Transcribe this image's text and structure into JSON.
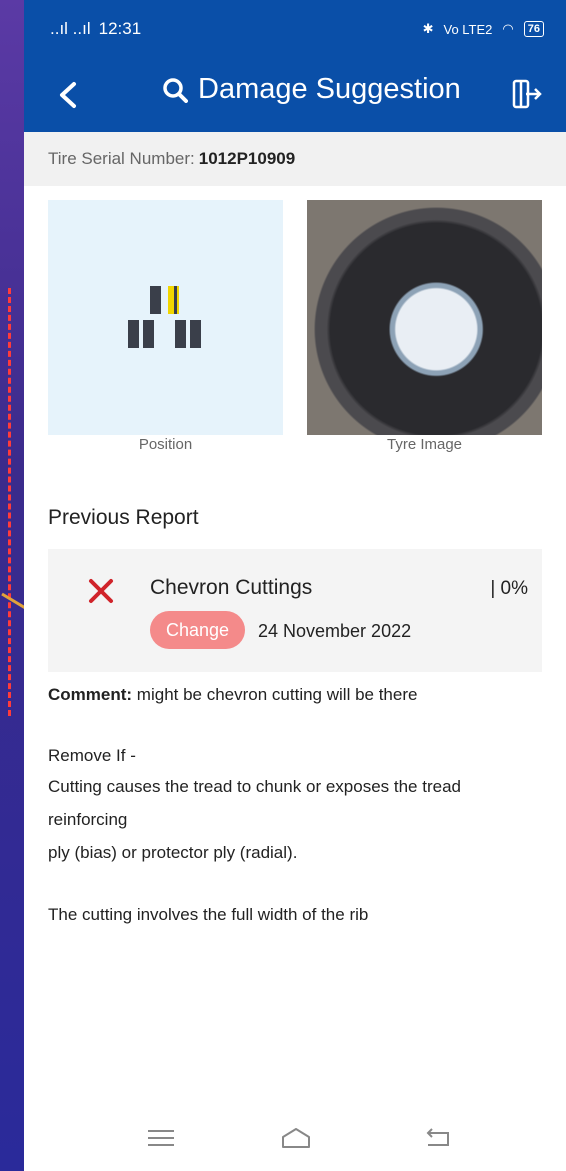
{
  "status_bar": {
    "signal": "..ıl ..ıl",
    "time": "12:31",
    "network": "Vo LTE2",
    "battery": "76"
  },
  "app_bar": {
    "title": "Damage Suggestion",
    "back_icon": "chevron-left-icon",
    "search_icon": "search-icon",
    "exit_icon": "exit-icon"
  },
  "tire": {
    "serial_label": "Tire Serial Number:",
    "serial_value": "1012P10909"
  },
  "images": {
    "position_caption": "Position",
    "tyre_caption": "Tyre Image"
  },
  "previous_report": {
    "heading": "Previous Report",
    "damage_name": "Chevron Cuttings",
    "percent": "| 0%",
    "change_label": "Change",
    "date": "24 November 2022"
  },
  "comment": {
    "label": "Comment:",
    "text": "might be chevron cutting will be there"
  },
  "guidance": {
    "remove_if": "Remove If -",
    "line1": "Cutting causes the tread to chunk or exposes the tread",
    "line2": "reinforcing",
    "line3": "ply (bias) or protector ply (radial).",
    "line4": "The cutting involves the full width of the rib"
  },
  "colors": {
    "app_bar": "#0a4fa8",
    "change_button": "#f48a8a",
    "x_icon": "#d0232a",
    "highlight_tire": "#f2d600"
  }
}
